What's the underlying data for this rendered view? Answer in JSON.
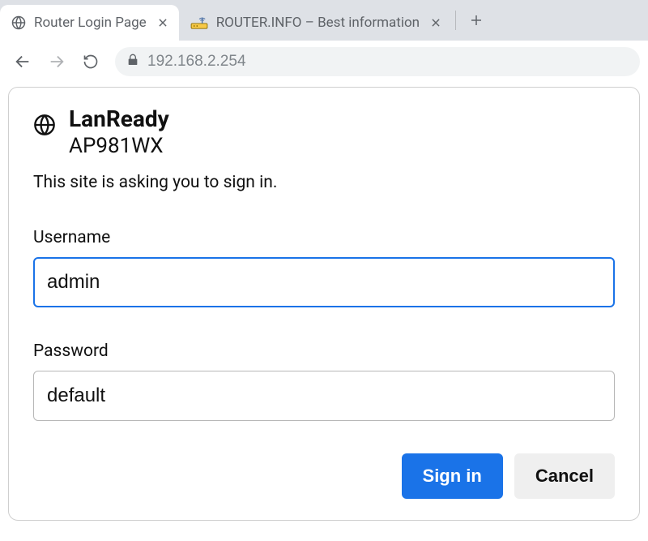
{
  "tabs": [
    {
      "title": "Router Login Page"
    },
    {
      "title": "ROUTER.INFO – Best information"
    }
  ],
  "address": {
    "url": "192.168.2.254"
  },
  "dialog": {
    "brand": "LanReady",
    "model": "AP981WX",
    "prompt": "This site is asking you to sign in.",
    "username_label": "Username",
    "username_value": "admin",
    "password_label": "Password",
    "password_value": "default",
    "signin_label": "Sign in",
    "cancel_label": "Cancel"
  }
}
